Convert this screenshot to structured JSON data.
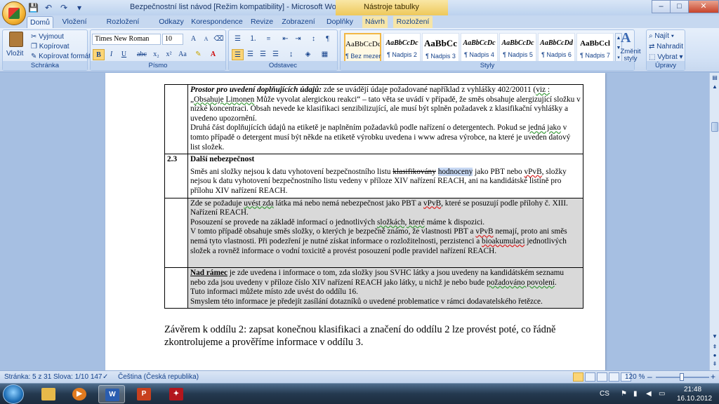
{
  "window": {
    "title": "Bezpečnostní list návod [Režim kompatibility] - Microsoft Word",
    "context_title": "Nástroje tabulky",
    "buttons": {
      "minimize": "–",
      "maximize": "□",
      "close": "✕"
    }
  },
  "tabs": [
    "Domů",
    "Vložení",
    "Rozložení stránky",
    "Odkazy",
    "Korespondence",
    "Revize",
    "Zobrazení",
    "Doplňky",
    "Návrh",
    "Rozložení"
  ],
  "ribbon": {
    "clipboard": {
      "label": "Schránka",
      "paste": "Vložit",
      "cut": "Vyjmout",
      "copy": "Kopírovat",
      "format_painter": "Kopírovat formát"
    },
    "font": {
      "label": "Písmo",
      "font_name": "Times New Roman",
      "font_size": "10",
      "bold": "B",
      "italic": "I",
      "underline": "U",
      "strike": "abc",
      "subscript": "x₂",
      "superscript": "x²",
      "change_case": "Aa",
      "grow": "A",
      "shrink": "A"
    },
    "paragraph": {
      "label": "Odstavec"
    },
    "styles": {
      "label": "Styly",
      "items": [
        {
          "sample": "AaBbCcDc",
          "name": "¶ Bez mezer"
        },
        {
          "sample": "AaBbCcDc",
          "name": "¶ Nadpis 2"
        },
        {
          "sample": "AaBbCc",
          "name": "¶ Nadpis 3"
        },
        {
          "sample": "AaBbCcDc",
          "name": "¶ Nadpis 4"
        },
        {
          "sample": "AaBbCcDc",
          "name": "¶ Nadpis 5"
        },
        {
          "sample": "AaBbCcDd",
          "name": "¶ Nadpis 6"
        },
        {
          "sample": "AaBbCcl",
          "name": "¶ Nadpis 7"
        }
      ],
      "change_styles": "Změnit styly"
    },
    "editing": {
      "label": "Úpravy",
      "find": "Najít",
      "replace": "Nahradit",
      "select": "Vybrat"
    }
  },
  "document": {
    "row1": {
      "p1_lead": "Prostor pro uvedení doplňujících údajů:",
      "p1_a": " zde se uvádějí údaje požadované například z vyhlášky 402/20011 (",
      "p1_viz": "viz :",
      "p1_b": " „",
      "p1_obsahuje": "Obsahuje Limonen",
      "p1_c": " Může vyvolat alergickou reakci“ – tato věta se uvádí v případě, že směs obsahuje alergizující složku v nízké koncentraci. Obsah nevede ke klasifikaci senzibilizující, ale musí být splněn požadavek z klasifikační vyhlášky a uvedeno upozornění.",
      "p2_a": "Druhá část doplňujících údajů na etiketě je naplněním požadavků podle nařízení o detergentech. Pokud se ",
      "p2_jedna": "jedná jako",
      "p2_b": " v tomto případě o detergent musí být někde na etiketě výrobku uvedena i www adresa výrobce, na které je uveden datový list složek."
    },
    "row2": {
      "number": "2.3",
      "heading": "Další nebezpečnost",
      "p1_a": "Směs ani složky nejsou k datu vyhotovení bezpečnostního listu ",
      "p1_struck": "klasifikovány",
      "p1_space": " ",
      "p1_hl": "hodnoceny",
      "p1_b": " jako PBT nebo ",
      "p1_vpvb": "vPvB",
      "p1_c": ", složky nejsou k datu vyhotovení bezpečnostního listu vedeny v příloze XIV nařízení REACH, ani na kandidátské listině pro přílohu XIV nařízení REACH."
    },
    "row3": {
      "l1_a": "Zde se požaduje ",
      "l1_u": "uvést zda",
      "l1_b": " látka má nebo nemá nebezpečnost jako PBT a ",
      "l1_v": "vPvB",
      "l1_c": ", které se posuzují podle přílohy č. XIII. Nařízení REACH.",
      "l2_a": "Posouzení se provede na základě informací o jednotlivých ",
      "l2_u": "složkách,  které",
      "l2_b": " máme k dispozici.",
      "l3_a": "V tomto případě obsahuje směs složky, o kterých je bezpečně známo, že vlastnosti PBT a ",
      "l3_v": "vPvB",
      "l3_b": " nemají, proto ani směs nemá tyto vlastnosti. Při podezření je nutné získat informace o rozložitelnosti, perzistenci a ",
      "l3_bio": "bioakumulaci",
      "l3_c": " jednotlivých složek a rovněž informace o vodní toxicitě a provést posouzení podle pravidel nařízení REACH."
    },
    "row4": {
      "lead": "Nad rámec",
      "p1_a": " je zde uvedena i informace o tom, zda složky jsou SVHC látky a jsou uvedeny na kandidátském seznamu nebo zda jsou uvedeny v příloze číslo XIV nařízení REACH jako látky, u nichž je nebo bude ",
      "p1_u": "požadováno povolení",
      "p1_b": ".",
      "p2": "Tuto informaci můžete místo zde uvést do oddílu 16.",
      "p3": "Smyslem této informace je předejít zasílání dotazníků o uvedené problematice v rámci dodavatelského řetězce."
    },
    "conclusion": "Závěrem k oddílu 2: zapsat konečnou klasifikaci a značení do oddílu 2 lze provést poté, co řádně zkontrolujeme a prověříme informace v oddílu 3."
  },
  "statusbar": {
    "page": "Stránka: 5 z 31",
    "words": "Slova: 1/10 147",
    "language": "Čeština (Česká republika)",
    "zoom": "120 %",
    "zoom_minus": "–",
    "zoom_plus": "+"
  },
  "taskbar": {
    "tray_lang": "CS",
    "time": "21:48",
    "date": "16.10.2012",
    "apps": [
      "explorer",
      "media-player",
      "word",
      "powerpoint",
      "acrobat"
    ]
  },
  "colors": {
    "accent": "#15428b",
    "ribbon_bg": "#dbe7f7",
    "context_tab": "#f6e5a7",
    "table_grey": "#d9d9d9",
    "highlight": "#c6d7f2"
  }
}
